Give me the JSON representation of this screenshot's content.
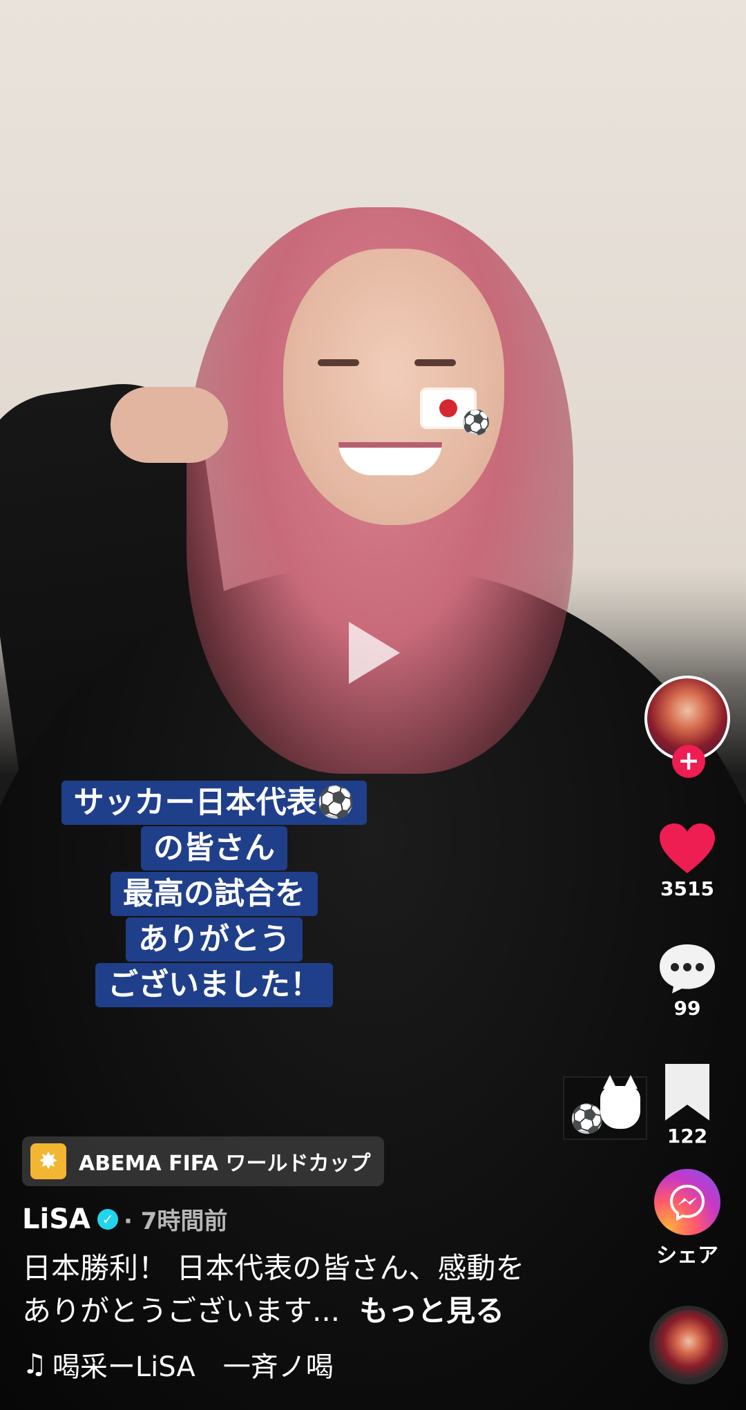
{
  "video": {
    "caption_lines": [
      "サッカー日本代表⚽",
      "の皆さん",
      "最高の試合を",
      "ありがとう",
      "ございました！"
    ]
  },
  "rail": {
    "like_count": "3515",
    "comment_count": "99",
    "bookmark_count": "122",
    "share_label": "シェア",
    "follow_symbol": "+"
  },
  "effect": {
    "label": "ABEMA FIFA ワールドカップ",
    "icon": "sparkle-icon"
  },
  "author": {
    "name": "LiSA",
    "verified_symbol": "✓",
    "time": "· 7時間前"
  },
  "description": {
    "line1": "日本勝利！ 日本代表の皆さん、感動を",
    "line2": "ありがとうございます...",
    "more": "もっと見る"
  },
  "music": {
    "note": "♫",
    "text": "喝采ーLiSA　一斉ノ喝"
  },
  "colors": {
    "like": "#ee1d52",
    "follow": "#ee1d52",
    "verified": "#20d5ec",
    "caption_bg": "#1f3f8a",
    "effect_icon_bg": "#f3b632"
  }
}
